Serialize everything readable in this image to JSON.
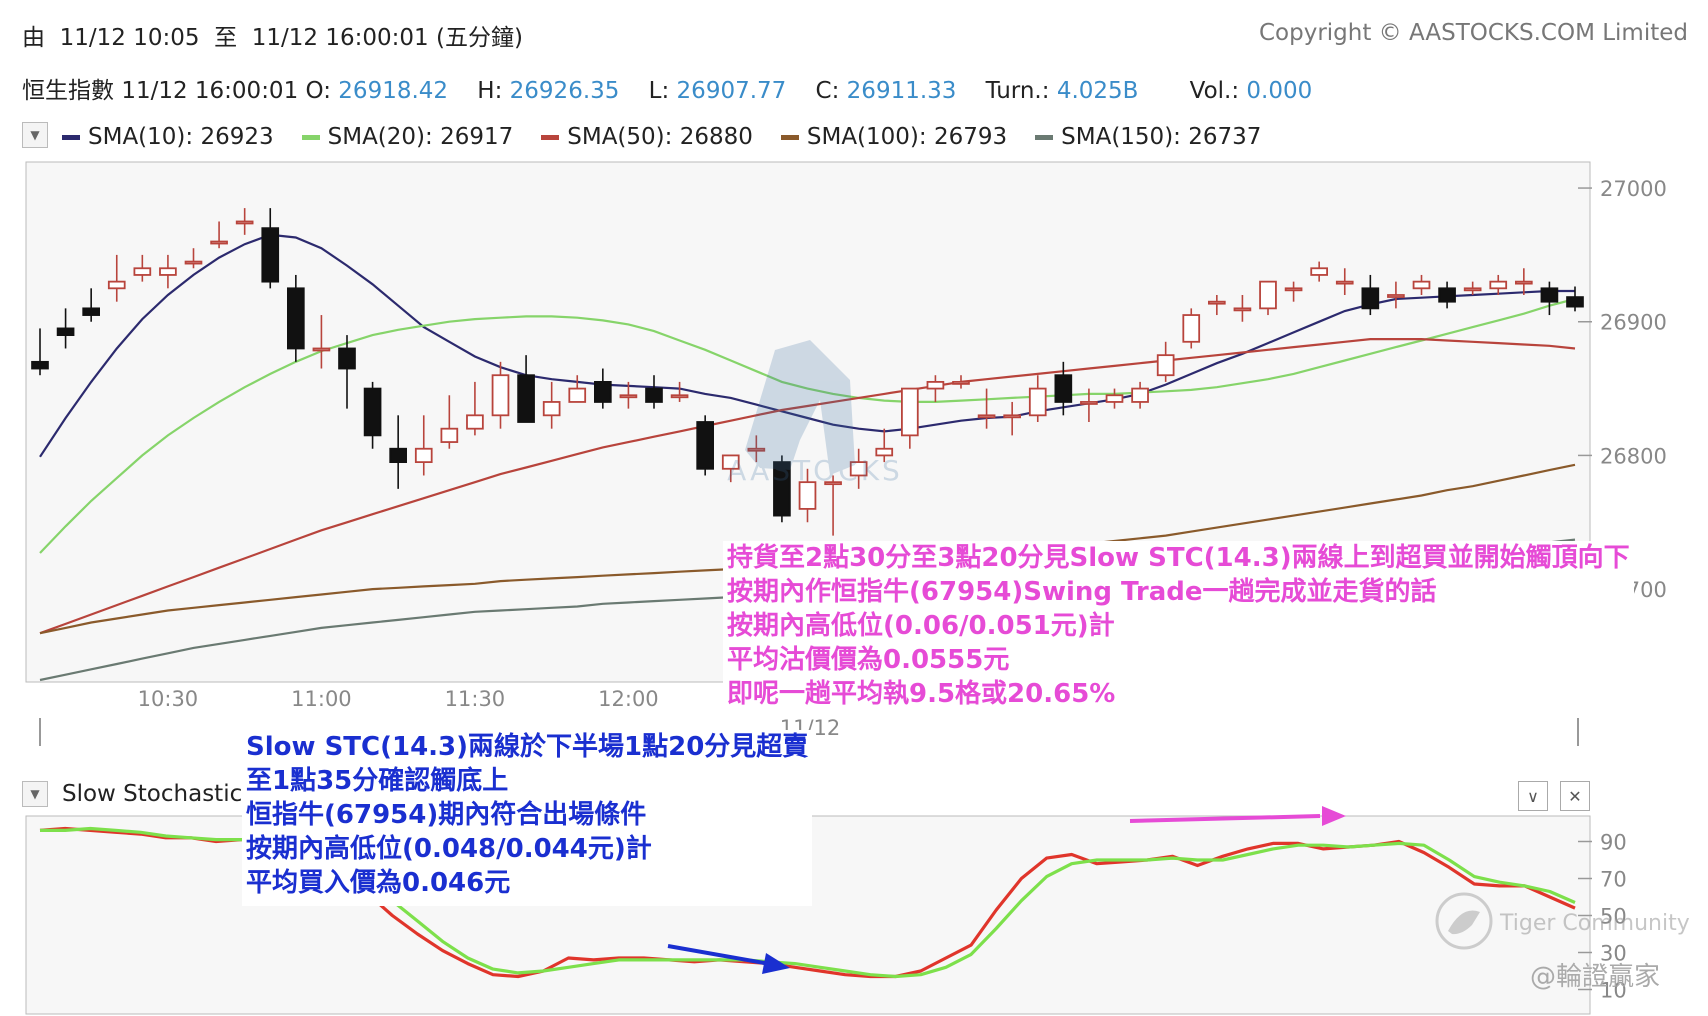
{
  "header": {
    "range_prefix": "由",
    "range_from": "11/12 10:05",
    "range_to_word": "至",
    "range_to": "11/12 16:00:01 (五分鐘)",
    "copyright": "Copyright © AASTOCKS.COM Limited"
  },
  "quote": {
    "name": "恒生指數",
    "time": "11/12 16:00:01",
    "o_label": "O:",
    "o_value": "26918.42",
    "h_label": "H:",
    "h_value": "26926.35",
    "l_label": "L:",
    "l_value": "26907.77",
    "c_label": "C:",
    "c_value": "26911.33",
    "turn_label": "Turn.:",
    "turn_value": "4.025B",
    "vol_label": "Vol.:",
    "vol_value": "0.000"
  },
  "legend": [
    {
      "label": "SMA(10): 26923",
      "color": "#2c2a6e"
    },
    {
      "label": "SMA(20): 26917",
      "color": "#86d46a"
    },
    {
      "label": "SMA(50): 26880",
      "color": "#b8443c"
    },
    {
      "label": "SMA(100): 26793",
      "color": "#8a5a2b"
    },
    {
      "label": "SMA(150): 26737",
      "color": "#6a7a72"
    }
  ],
  "watermark": "AASTOCKS",
  "date_marker": "11/12",
  "stoch_title": "Slow Stochastic",
  "stoch_buttons": {
    "minimize": "∨",
    "close": "✕"
  },
  "annotation_top": [
    "持貨至2點30分至3點20分見Slow STC(14.3)兩線上到超買並開始觸頂向下",
    "按期內作恒指牛(67954)Swing Trade一趟完成並走貨的話",
    "按期內高低位(0.06/0.051元)計",
    "平均沽價價為0.0555元",
    "即呢一趟平均執9.5格或20.65%"
  ],
  "annotation_bottom": [
    "Slow STC(14.3)兩線於下半場1點20分見超賣",
    "至1點35分確認觸底上",
    "恒指牛(67954)期內符合出場條件",
    "按期內高低位(0.048/0.044元)計",
    "平均買入價為0.046元"
  ],
  "footer_watermarks": {
    "tiger": "Tiger Community",
    "author": "@輪證贏家"
  },
  "colors": {
    "up": "#b8443c",
    "down": "#111111",
    "pink": "#e64bd6",
    "navy": "#1a2fd0",
    "k_line": "#e0352b",
    "d_line": "#7de04b"
  },
  "chart_data": [
    {
      "type": "candlestick",
      "title": "恒生指數",
      "x_tick_labels": [
        "10:30",
        "11:00",
        "11:30",
        "12:00"
      ],
      "ylim": [
        26635,
        27015
      ],
      "y_ticks": [
        27000,
        26900,
        26800,
        26700
      ],
      "ohlc": [
        [
          26870,
          26895,
          26865,
          26860
        ],
        [
          26895,
          26910,
          26890,
          26880
        ],
        [
          26910,
          26925,
          26905,
          26900
        ],
        [
          26925,
          26950,
          26930,
          26915
        ],
        [
          26935,
          26950,
          26940,
          26930
        ],
        [
          26935,
          26950,
          26940,
          26925
        ],
        [
          26945,
          26955,
          26945,
          26940
        ],
        [
          26960,
          26975,
          26960,
          26955
        ],
        [
          26975,
          26985,
          26975,
          26965
        ],
        [
          26970,
          26985,
          26930,
          26925
        ],
        [
          26925,
          26935,
          26880,
          26870
        ],
        [
          26880,
          26905,
          26880,
          26865
        ],
        [
          26880,
          26890,
          26865,
          26835
        ],
        [
          26850,
          26855,
          26815,
          26805
        ],
        [
          26805,
          26830,
          26795,
          26775
        ],
        [
          26795,
          26830,
          26805,
          26785
        ],
        [
          26810,
          26845,
          26820,
          26805
        ],
        [
          26820,
          26855,
          26830,
          26815
        ],
        [
          26830,
          26870,
          26860,
          26820
        ],
        [
          26860,
          26875,
          26825,
          26825
        ],
        [
          26830,
          26855,
          26840,
          26820
        ],
        [
          26840,
          26860,
          26850,
          26840
        ],
        [
          26855,
          26865,
          26840,
          26835
        ],
        [
          26845,
          26855,
          26845,
          26835
        ],
        [
          26850,
          26860,
          26840,
          26835
        ],
        [
          26845,
          26855,
          26845,
          26840
        ],
        [
          26825,
          26830,
          26790,
          26785
        ],
        [
          26790,
          26800,
          26800,
          26780
        ],
        [
          26805,
          26815,
          26805,
          26795
        ],
        [
          26795,
          26800,
          26755,
          26750
        ],
        [
          26760,
          26790,
          26780,
          26750
        ],
        [
          26780,
          26785,
          26780,
          26740
        ],
        [
          26785,
          26805,
          26795,
          26775
        ],
        [
          26800,
          26820,
          26805,
          26795
        ],
        [
          26815,
          26825,
          26850,
          26805
        ],
        [
          26850,
          26860,
          26855,
          26840
        ],
        [
          26855,
          26860,
          26855,
          26850
        ],
        [
          26830,
          26850,
          26830,
          26820
        ],
        [
          26830,
          26840,
          26830,
          26815
        ],
        [
          26830,
          26860,
          26850,
          26825
        ],
        [
          26860,
          26870,
          26840,
          26830
        ],
        [
          26840,
          26850,
          26840,
          26825
        ],
        [
          26840,
          26850,
          26845,
          26835
        ],
        [
          26840,
          26855,
          26850,
          26835
        ],
        [
          26860,
          26885,
          26875,
          26855
        ],
        [
          26885,
          26910,
          26905,
          26880
        ],
        [
          26915,
          26920,
          26915,
          26905
        ],
        [
          26910,
          26920,
          26910,
          26900
        ],
        [
          26910,
          26930,
          26930,
          26905
        ],
        [
          26925,
          26930,
          26925,
          26915
        ],
        [
          26935,
          26945,
          26940,
          26930
        ],
        [
          26930,
          26940,
          26930,
          26920
        ],
        [
          26925,
          26935,
          26910,
          26905
        ],
        [
          26920,
          26930,
          26920,
          26910
        ],
        [
          26925,
          26935,
          26930,
          26920
        ],
        [
          26925,
          26930,
          26915,
          26910
        ],
        [
          26925,
          26930,
          26925,
          26920
        ],
        [
          26925,
          26935,
          26930,
          26920
        ],
        [
          26930,
          26940,
          26930,
          26920
        ],
        [
          26925,
          26930,
          26915,
          26905
        ],
        [
          26918.42,
          26926.35,
          26911.33,
          26907.77
        ]
      ],
      "series": [
        {
          "name": "SMA(10)",
          "color": "#2c2a6e",
          "values": [
            26799,
            26828,
            26855,
            26880,
            26902,
            26920,
            26935,
            26948,
            26958,
            26965,
            26963,
            26955,
            26942,
            26928,
            26912,
            26896,
            26885,
            26874,
            26866,
            26860,
            26857,
            26855,
            26853,
            26852,
            26851,
            26850,
            26846,
            26843,
            26838,
            26833,
            26828,
            26823,
            26820,
            26818,
            26820,
            26823,
            26826,
            26828,
            26829,
            26833,
            26836,
            26839,
            26842,
            26846,
            26853,
            26861,
            26869,
            26876,
            26884,
            26892,
            26900,
            26908,
            26913,
            26917,
            26918,
            26919,
            26920,
            26921,
            26922,
            26923,
            26923
          ]
        },
        {
          "name": "SMA(20)",
          "color": "#86d46a",
          "values": [
            26727,
            26747,
            26766,
            26783,
            26800,
            26815,
            26828,
            26840,
            26851,
            26861,
            26870,
            26878,
            26884,
            26890,
            26894,
            26897,
            26900,
            26902,
            26903,
            26904,
            26904,
            26903,
            26901,
            26898,
            26893,
            26886,
            26879,
            26871,
            26863,
            26855,
            26850,
            26846,
            26843,
            26841,
            26840,
            26840,
            26841,
            26842,
            26843,
            26844,
            26845,
            26846,
            26846,
            26847,
            26848,
            26849,
            26851,
            26854,
            26857,
            26861,
            26866,
            26871,
            26876,
            26881,
            26886,
            26891,
            26896,
            26901,
            26906,
            26912,
            26917
          ]
        },
        {
          "name": "SMA(50)",
          "color": "#b8443c",
          "values": [
            26667,
            26674,
            26681,
            26688,
            26695,
            26702,
            26709,
            26716,
            26723,
            26730,
            26737,
            26744,
            26750,
            26756,
            26762,
            26768,
            26774,
            26780,
            26786,
            26791,
            26796,
            26801,
            26806,
            26810,
            26814,
            26818,
            26822,
            26826,
            26830,
            26834,
            26837,
            26840,
            26843,
            26846,
            26849,
            26852,
            26855,
            26857,
            26859,
            26861,
            26863,
            26865,
            26867,
            26869,
            26871,
            26873,
            26875,
            26877,
            26879,
            26881,
            26883,
            26885,
            26887,
            26887,
            26887,
            26886,
            26885,
            26884,
            26883,
            26882,
            26880
          ]
        },
        {
          "name": "SMA(100)",
          "color": "#8a5a2b",
          "values": [
            26667,
            26671,
            26675,
            26678,
            26681,
            26684,
            26686,
            26688,
            26690,
            26692,
            26694,
            26696,
            26698,
            26700,
            26701,
            26702,
            26703,
            26704,
            26706,
            26707,
            26708,
            26709,
            26710,
            26711,
            26712,
            26713,
            26714,
            26715,
            26716,
            26717,
            26718,
            26719,
            26720,
            26721,
            26722,
            26724,
            26725,
            26727,
            26728,
            26730,
            26732,
            26734,
            26736,
            26738,
            26740,
            26743,
            26746,
            26749,
            26752,
            26755,
            26758,
            26761,
            26764,
            26767,
            26770,
            26774,
            26777,
            26781,
            26785,
            26789,
            26793
          ]
        },
        {
          "name": "SMA(150)",
          "color": "#6a7a72",
          "values": [
            26632,
            26636,
            26640,
            26644,
            26648,
            26652,
            26656,
            26659,
            26662,
            26665,
            26668,
            26671,
            26673,
            26675,
            26677,
            26679,
            26681,
            26683,
            26684,
            26685,
            26686,
            26687,
            26689,
            26690,
            26691,
            26692,
            26693,
            26694,
            26696,
            26697,
            26698,
            26699,
            26700,
            26701,
            26702,
            26703,
            26704,
            26705,
            26706,
            26707,
            26708,
            26709,
            26710,
            26711,
            26712,
            26714,
            26715,
            26716,
            26717,
            26719,
            26720,
            26721,
            26722,
            26724,
            26725,
            26727,
            26729,
            26731,
            26733,
            26735,
            26737
          ]
        }
      ]
    },
    {
      "type": "line",
      "title": "Slow Stochastic",
      "ylim": [
        0,
        100
      ],
      "y_ticks": [
        90,
        70,
        50,
        30,
        10
      ],
      "series": [
        {
          "name": "%K",
          "color": "#e0352b",
          "values": [
            96,
            97,
            96,
            95,
            94,
            92,
            92,
            90,
            91,
            89,
            86,
            82,
            74,
            62,
            50,
            40,
            31,
            24,
            18,
            17,
            20,
            27,
            26,
            27,
            27,
            26,
            25,
            26,
            25,
            24,
            22,
            20,
            18,
            17,
            17,
            20,
            27,
            34,
            53,
            70,
            81,
            83,
            78,
            79,
            80,
            82,
            77,
            82,
            86,
            89,
            89,
            86,
            87,
            88,
            90,
            84,
            76,
            67,
            66,
            66,
            60,
            54
          ]
        },
        {
          "name": "%D",
          "color": "#7de04b",
          "values": [
            96,
            96,
            97,
            96,
            95,
            93,
            92,
            91,
            91,
            90,
            88,
            85,
            79,
            70,
            58,
            47,
            36,
            27,
            21,
            19,
            20,
            22,
            24,
            26,
            26,
            26,
            26,
            26,
            26,
            25,
            24,
            22,
            20,
            18,
            17,
            18,
            22,
            29,
            43,
            58,
            71,
            78,
            80,
            80,
            80,
            81,
            80,
            80,
            83,
            86,
            88,
            88,
            87,
            88,
            89,
            88,
            80,
            71,
            68,
            66,
            63,
            57
          ]
        }
      ]
    }
  ]
}
